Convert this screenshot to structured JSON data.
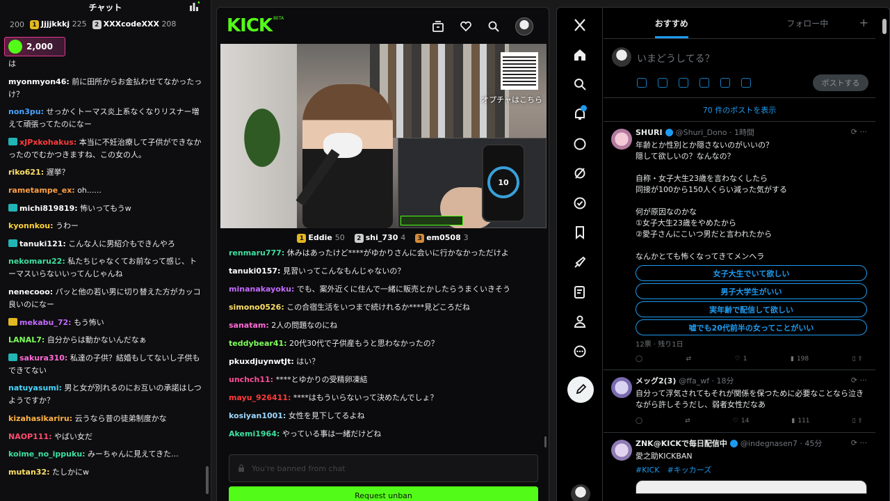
{
  "left_chat": {
    "title": "チャット",
    "top_gifters": [
      {
        "rank": "",
        "name": "",
        "count": "200"
      },
      {
        "rank": "1",
        "name": "Jjjjkkkj",
        "count": "225"
      },
      {
        "rank": "2",
        "name": "XXXcodeXXX",
        "count": "208"
      }
    ],
    "gift_amount": "2,000",
    "messages": [
      {
        "user": "",
        "text": "は",
        "color": "#ffffff",
        "badge": ""
      },
      {
        "user": "myonmyon46:",
        "text": " 前に田所からお金払わせてなかったっけ？",
        "color": "#ffffff",
        "badge": ""
      },
      {
        "user": "non3pu:",
        "text": " せっかくトーマス炎上系なくなりリスナー増えて頑張ってたのになー",
        "color": "#4aa3ff",
        "badge": ""
      },
      {
        "user": "xJPxkohakus:",
        "text": " 本当に不妊治療して子供ができなかったのでむかつきますね、この女の人。",
        "color": "#ff3b3b",
        "badge": "t"
      },
      {
        "user": "riko621:",
        "text": " 遅挙？",
        "color": "#ffe066",
        "badge": ""
      },
      {
        "user": "rametampe_ex:",
        "text": " oh......",
        "color": "#ff9f43",
        "badge": ""
      },
      {
        "user": "michi819819:",
        "text": " 怖いってもうw",
        "color": "#ffffff",
        "badge": "t"
      },
      {
        "user": "kyonnkou:",
        "text": " うわー",
        "color": "#ffd23f",
        "badge": ""
      },
      {
        "user": "tanuki121:",
        "text": " こんな人に男紹介もできんやろ",
        "color": "#ffffff",
        "badge": "t"
      },
      {
        "user": "nekomaru22:",
        "text": " 私たちじゃなくてお前なって感じ、トーマスいらないいってんじゃんね",
        "color": "#3ee0a0",
        "badge": ""
      },
      {
        "user": "nenecooo:",
        "text": " パッと他の若い男に切り替えた方がカッコ良いのになー",
        "color": "#ffffff",
        "badge": ""
      },
      {
        "user": "mekabu_72:",
        "text": " もう怖い",
        "color": "#c36bff",
        "badge": "y"
      },
      {
        "user": "LANAL7:",
        "text": " 自分からは動かないんだなぁ",
        "color": "#7dff5a",
        "badge": ""
      },
      {
        "user": "sakura310:",
        "text": " 私達の子供？結婚もしてないし子供もできてない",
        "color": "#ff6bd5",
        "badge": "t"
      },
      {
        "user": "natuyasumi:",
        "text": " 男と女が別れるのにお互いの承諾はしつようですか？",
        "color": "#4ad6ff",
        "badge": ""
      },
      {
        "user": "kizahasikariru:",
        "text": " 云うなら昔の徒弟制度かな",
        "color": "#ffb347",
        "badge": ""
      },
      {
        "user": "NAOP111:",
        "text": " やばい女だ",
        "color": "#ff4d6d",
        "badge": ""
      },
      {
        "user": "koime_no_ippuku:",
        "text": " みーちゃんに見えてきた...",
        "color": "#3ee0a0",
        "badge": ""
      },
      {
        "user": "mutan32:",
        "text": " たしかにw",
        "color": "#ffe066",
        "badge": ""
      }
    ]
  },
  "kick": {
    "logo": "KICK",
    "beta": "BETA",
    "qr_caption": "オプチャはこちら",
    "gauge_value": "10",
    "leaderboard": [
      {
        "rank": "1",
        "name": "Eddie",
        "count": "50",
        "color": "#e3b820"
      },
      {
        "rank": "2",
        "name": "shi_730",
        "count": "4",
        "color": "#cfcfcf"
      },
      {
        "rank": "3",
        "name": "em0508",
        "count": "3",
        "color": "#d58a3a"
      }
    ],
    "messages": [
      {
        "user": "renmaru777:",
        "text": " 休みはあったけど****がゆかりさんに会いに行かなかっただけよ",
        "color": "#3ee0a0"
      },
      {
        "user": "tanuki0157:",
        "text": " 見習いってこんなもんじゃないの？",
        "color": "#ffffff"
      },
      {
        "user": "minanakayoku:",
        "text": " でも、案外近くに住んで一緒に販売とかしたらうまくいきそう",
        "color": "#c36bff"
      },
      {
        "user": "simono0526:",
        "text": " この合宿生活をいつまで続けれるか****見どころだね",
        "color": "#ffe066"
      },
      {
        "user": "sanatam:",
        "text": " 2人の問題なのにね",
        "color": "#ff6bd5"
      },
      {
        "user": "teddybear41:",
        "text": " 20代30代で子供産もうと思わなかったの？",
        "color": "#7dff5a"
      },
      {
        "user": "pkuxdjuynwtJt:",
        "text": " はい？",
        "color": "#ffffff"
      },
      {
        "user": "unchch11:",
        "text": " ****とゆかりの受精卵凍結",
        "color": "#ff4d9a"
      },
      {
        "user": "mayu_926411:",
        "text": " ****はもういらないって決めたんでしょ？",
        "color": "#ff3b3b"
      },
      {
        "user": "kosiyan1001:",
        "text": " 女性を見下してるよね",
        "color": "#9fd8ff"
      },
      {
        "user": "Akemi1964:",
        "text": " やっている事は一緒だけどね",
        "color": "#3ee0a0"
      }
    ],
    "input_placeholder": "You're banned from chat",
    "unban_label": "Request unban"
  },
  "x": {
    "tabs": [
      "おすすめ",
      "フォロー中"
    ],
    "compose_placeholder": "いまどうしてる？",
    "post_label": "ポストする",
    "show_more": "70 件のポストを表示",
    "tweets": [
      {
        "name": "SHURI",
        "handle": "@Shuri_Dono · 1時間",
        "body": "年齢とか性別とか隠さないのがいいの？\n隠して欲しいの？なんなの？\n\n自称・女子大生23歳を言わなくしたら\n同接が100から150人くらい減った気がする\n\n何が原因なのかな\n①女子大生23歳をやめたから\n②愛子さんにこいつ男だと言われたから\n\nなんかとても怖くなってきてメンヘラ",
        "poll": [
          "女子大生でいて欲しい",
          "男子大学生がいい",
          "実年齢で配信して欲しい",
          "嘘でも20代前半の女ってことがいい"
        ],
        "poll_meta": "12票 · 残り1日",
        "replies": "",
        "retweets": "",
        "likes": "1",
        "views": "198"
      },
      {
        "name": "メッグ2(3)",
        "handle": "@ffa_wf · 18分",
        "body": "自分って浮気されてもそれが関係を保つために必要なことなら泣きながら許しそうだし、弱者女性だなあ",
        "likes": "14",
        "views": "111"
      },
      {
        "name": "ZNK@KICKで毎日配信中",
        "handle": "@indegnasen7 · 45分",
        "body": "愛之助KICKBAN",
        "tags": "#KICK　#キッカーズ"
      }
    ],
    "accent": "#1d9bf0"
  }
}
